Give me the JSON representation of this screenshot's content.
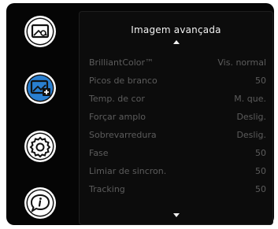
{
  "menu": {
    "title": "Imagem avançada",
    "icons": [
      "picture-icon",
      "advanced-picture-icon",
      "settings-gear-icon",
      "info-icon"
    ],
    "selected_icon": "advanced-picture-icon",
    "items": [
      {
        "label": "BrilliantColor™",
        "value": "Vis. normal"
      },
      {
        "label": "Picos de branco",
        "value": "50"
      },
      {
        "label": "Temp. de cor",
        "value": "M. que."
      },
      {
        "label": "Forçar amplo",
        "value": "Deslig."
      },
      {
        "label": "Sobrevarredura",
        "value": "Deslig."
      },
      {
        "label": "Fase",
        "value": "50"
      },
      {
        "label": "Limiar de sincron.",
        "value": "50"
      },
      {
        "label": "Tracking",
        "value": "50"
      }
    ]
  },
  "colors": {
    "osd_background": "#050505",
    "selected_icon_fill": "#2a7fd0",
    "text_bright": "#f2f2f2",
    "text_dim": "#5c5c5c"
  }
}
